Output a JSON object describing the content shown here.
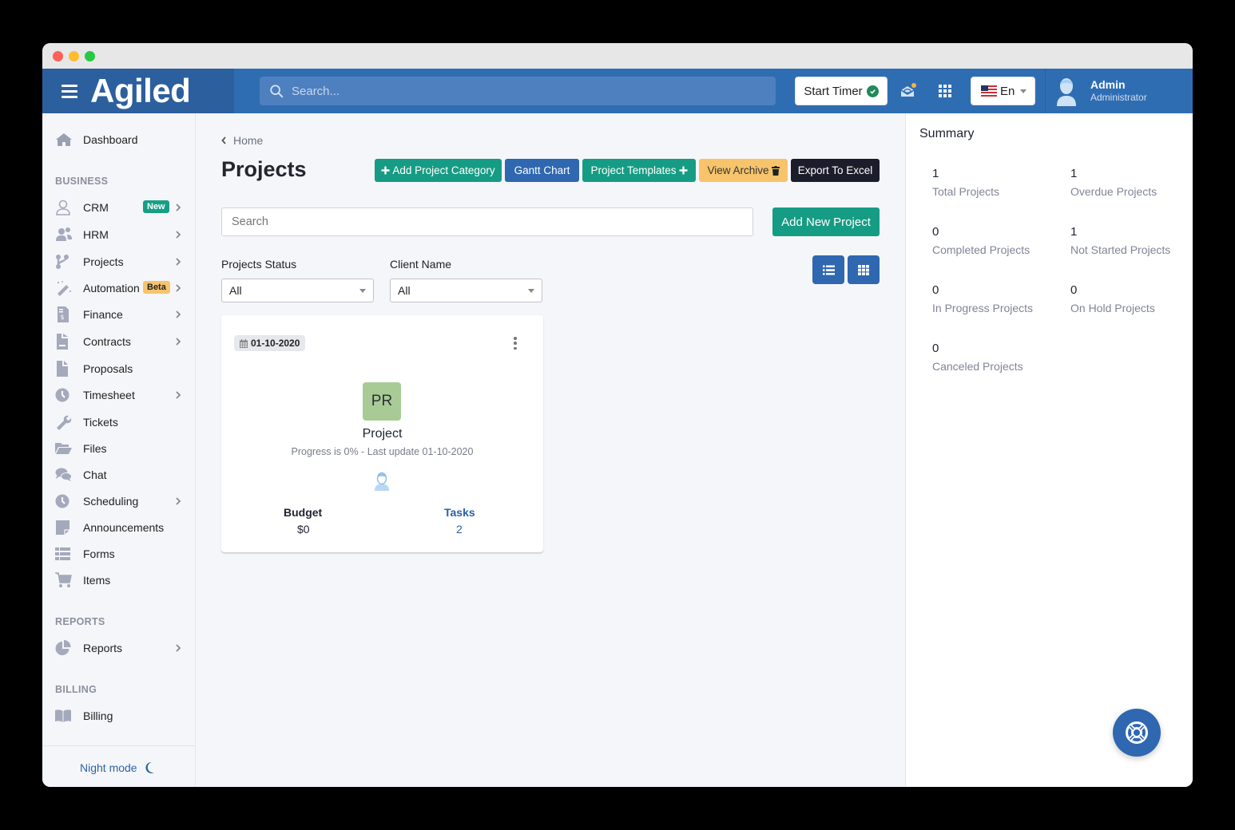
{
  "app": {
    "brand": "Agiled",
    "search_placeholder": "Search...",
    "start_timer_label": "Start Timer",
    "language_label": "En",
    "user": {
      "name": "Admin",
      "role": "Administrator"
    }
  },
  "sidebar": {
    "items": [
      {
        "label": "Dashboard",
        "icon": "home-icon"
      },
      {
        "label": "CRM",
        "icon": "user-icon",
        "badge": "New",
        "has_submenu": true
      },
      {
        "label": "HRM",
        "icon": "users-icon",
        "has_submenu": true
      },
      {
        "label": "Projects",
        "icon": "project-diagram-icon",
        "has_submenu": true
      },
      {
        "label": "Automation",
        "icon": "magic-wand-icon",
        "badge": "Beta",
        "has_submenu": true
      },
      {
        "label": "Finance",
        "icon": "invoice-dollar-icon",
        "has_submenu": true
      },
      {
        "label": "Contracts",
        "icon": "contract-icon",
        "has_submenu": true
      },
      {
        "label": "Proposals",
        "icon": "file-icon"
      },
      {
        "label": "Timesheet",
        "icon": "clock-icon",
        "has_submenu": true
      },
      {
        "label": "Tickets",
        "icon": "wrench-icon"
      },
      {
        "label": "Files",
        "icon": "folder-open-icon"
      },
      {
        "label": "Chat",
        "icon": "comments-icon"
      },
      {
        "label": "Scheduling",
        "icon": "clock-icon",
        "has_submenu": true
      },
      {
        "label": "Announcements",
        "icon": "sticky-note-icon"
      },
      {
        "label": "Forms",
        "icon": "list-icon"
      },
      {
        "label": "Items",
        "icon": "cart-icon"
      },
      {
        "label": "Reports",
        "icon": "pie-chart-icon",
        "has_submenu": true
      },
      {
        "label": "Billing",
        "icon": "book-open-icon"
      }
    ],
    "sections": {
      "business": "BUSINESS",
      "reports": "REPORTS",
      "billing": "BILLING"
    },
    "night_mode_label": "Night mode"
  },
  "main": {
    "breadcrumb": "Home",
    "title": "Projects",
    "actions": {
      "add_category": "Add Project Category",
      "gantt": "Gantt Chart",
      "templates": "Project Templates",
      "archive": "View Archive",
      "export": "Export To Excel"
    },
    "search_placeholder": "Search",
    "add_project_label": "Add New Project",
    "filters": {
      "status_label": "Projects Status",
      "status_value": "All",
      "client_label": "Client Name",
      "client_value": "All"
    },
    "projects": [
      {
        "date": "01-10-2020",
        "initials": "PR",
        "name": "Project",
        "progress_text": "Progress is 0% - Last update 01-10-2020",
        "progress_percent": 0,
        "budget_label": "Budget",
        "budget_value": "$0",
        "tasks_label": "Tasks",
        "tasks_value": "2"
      }
    ]
  },
  "summary": {
    "title": "Summary",
    "items": [
      {
        "value": "1",
        "label": "Total Projects"
      },
      {
        "value": "1",
        "label": "Overdue Projects"
      },
      {
        "value": "0",
        "label": "Completed Projects"
      },
      {
        "value": "1",
        "label": "Not Started Projects"
      },
      {
        "value": "0",
        "label": "In Progress Projects"
      },
      {
        "value": "0",
        "label": "On Hold Projects"
      },
      {
        "value": "0",
        "label": "Canceled Projects"
      }
    ]
  },
  "colors": {
    "primary": "#2f6db3",
    "success": "#169c84",
    "warning": "#f7c46c",
    "dark": "#1c1d2b",
    "project_avatar": "#a8cb96"
  }
}
